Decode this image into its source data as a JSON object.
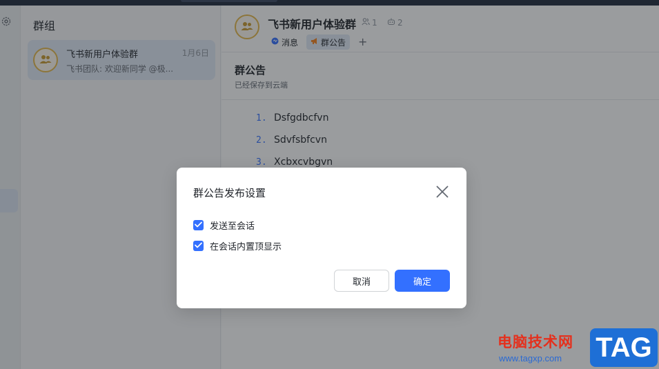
{
  "sidebar": {
    "title": "群组"
  },
  "chat_list": {
    "items": [
      {
        "name": "飞书新用户体验群",
        "date": "1月6日",
        "preview": "飞书团队: 欢迎新同学 @极..."
      }
    ]
  },
  "header": {
    "group_name": "飞书新用户体验群",
    "members_count": "1",
    "bots_count": "2",
    "tabs": [
      {
        "label": "消息",
        "icon": "message-icon"
      },
      {
        "label": "群公告",
        "icon": "megaphone-icon"
      }
    ],
    "add_tab": "+"
  },
  "notice": {
    "title": "群公告",
    "subtitle": "已经保存到云端",
    "items": [
      {
        "num": "1.",
        "text": "Dsfgdbcfvn"
      },
      {
        "num": "2.",
        "text": "Sdvfsbfcvn"
      },
      {
        "num": "3.",
        "text": "Xcbxcvbgvn"
      }
    ]
  },
  "dialog": {
    "title": "群公告发布设置",
    "options": [
      {
        "label": "发送至会话",
        "checked": true
      },
      {
        "label": "在会话内置顶显示",
        "checked": true
      }
    ],
    "cancel_label": "取消",
    "confirm_label": "确定"
  },
  "watermark": {
    "site_name": "电脑技术网",
    "url": "www.tagxp.com",
    "tag": "TAG"
  },
  "colors": {
    "accent": "#3370ff",
    "avatar_ring": "#e6b84a",
    "watermark_red": "#e5301d",
    "watermark_blue": "#1e6fd6"
  }
}
